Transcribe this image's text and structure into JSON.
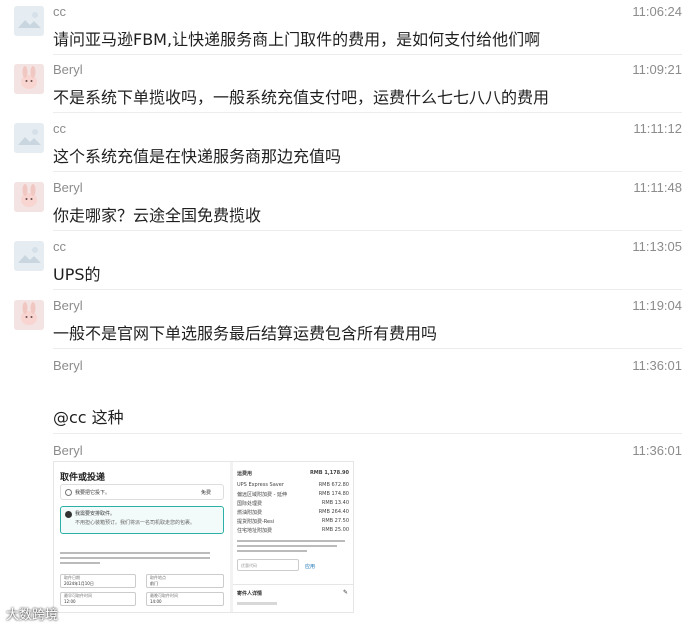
{
  "messages": [
    {
      "sender": "cc",
      "time": "11:06:24",
      "text": "请问亚马逊FBM,让快递服务商上门取件的费用，是如何支付给他们啊"
    },
    {
      "sender": "Beryl",
      "time": "11:09:21",
      "text": "不是系统下单揽收吗，一般系统充值支付吧，运费什么七七八八的费用"
    },
    {
      "sender": "cc",
      "time": "11:11:12",
      "text": "这个系统充值是在快递服务商那边充值吗"
    },
    {
      "sender": "Beryl",
      "time": "11:11:48",
      "text": "你走哪家？云途全国免费揽收"
    },
    {
      "sender": "cc",
      "time": "11:13:05",
      "text": "UPS的"
    },
    {
      "sender": "Beryl",
      "time": "11:19:04",
      "text": "一般不是官网下单选服务最后结算运费包含所有费用吗"
    },
    {
      "sender": "Beryl",
      "time": "11:36:01",
      "text": "@cc 这种"
    },
    {
      "sender": "Beryl",
      "time": "11:36:01",
      "text": ""
    }
  ],
  "screenshot": {
    "title": "取件或投递",
    "option1": "我要把它投下。",
    "option1_right": "免费",
    "option2_title": "我需要安排取件。",
    "option2_sub": "不用担心装箱预订。我们将派一名司机取走您的包裹。",
    "summary_title": "运费用",
    "summary_total": "RMB 1,178.90",
    "summary_rows": [
      {
        "label": "UPS Express Saver",
        "value": "RMB 672.80"
      },
      {
        "label": "偏远区域附加费 - 延伸",
        "value": "RMB 174.80"
      },
      {
        "label": "国际处理费",
        "value": "RMB 13.40"
      },
      {
        "label": "燃油附加费",
        "value": "RMB 264.40"
      },
      {
        "label": "提货附加费-Resi",
        "value": "RMB 27.50"
      },
      {
        "label": "住宅地址附加费",
        "value": "RMB 25.00"
      }
    ],
    "promo_placeholder": "优惠代码",
    "promo_apply": "应用",
    "shipper_details": "寄件人详情",
    "date_label": "取件日期",
    "date_value": "2024年1月10日",
    "location_label": "取件地点",
    "location_value": "前门",
    "earliest_label": "最早可取件时间",
    "earliest_value": "12:00",
    "latest_label": "最晚可取件时间",
    "latest_value": "14:00"
  },
  "watermark": "大数跨境"
}
